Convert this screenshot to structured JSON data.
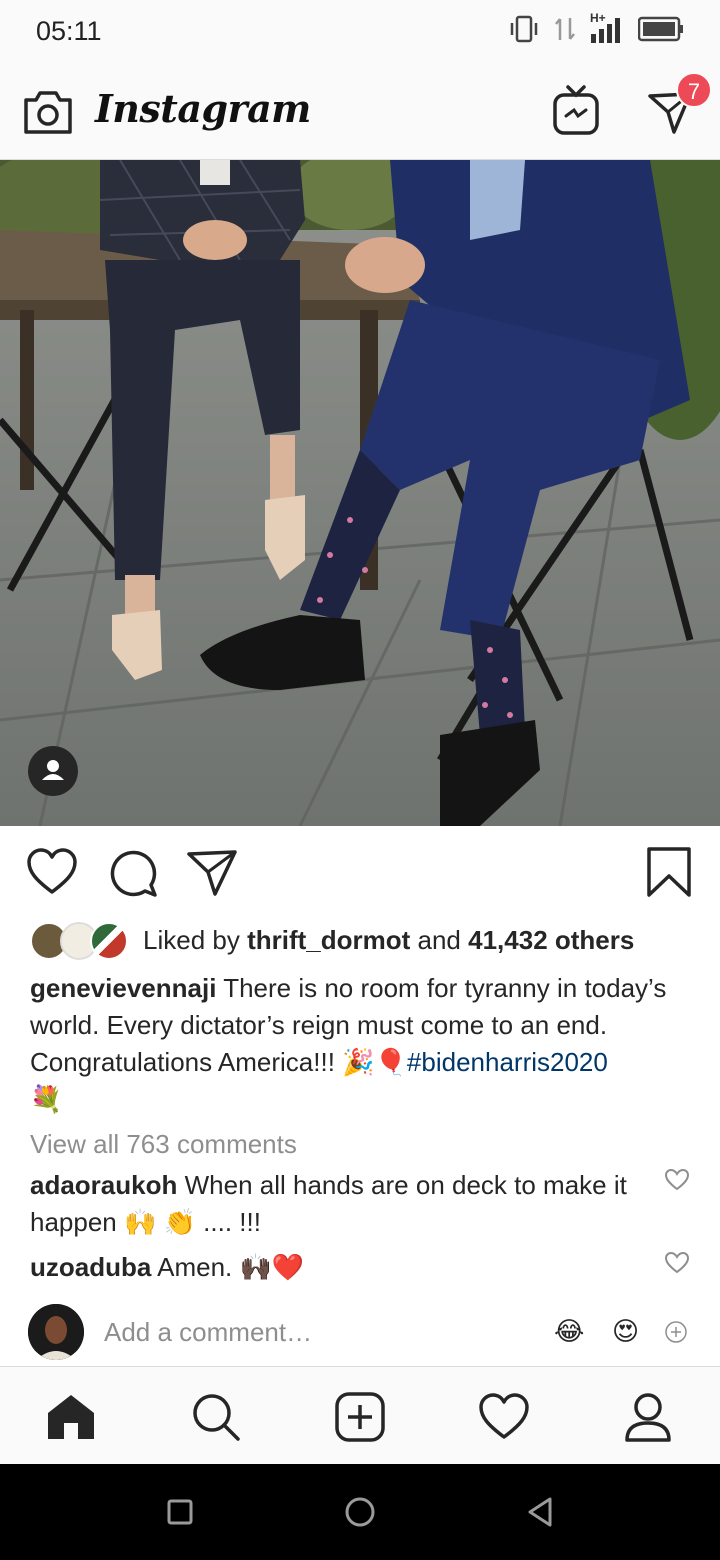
{
  "status_bar": {
    "time": "05:11",
    "network_label": "H+",
    "icons": [
      "vibrate-icon",
      "data-transfer-icon",
      "signal-icon",
      "battery-icon"
    ]
  },
  "header": {
    "app_title": "Instagram",
    "notification_count": "7",
    "icons": [
      "camera-icon",
      "igtv-icon",
      "direct-message-icon"
    ]
  },
  "post": {
    "actions": [
      "heart-icon",
      "comment-icon",
      "share-icon",
      "bookmark-icon"
    ],
    "likes": {
      "prefix": "Liked by",
      "user": "thrift_dormot",
      "connector": "and",
      "others": "41,432 others"
    },
    "caption": {
      "username": "genevievennaji",
      "text": "There is no room for tyranny in today’s world. Every dictator’s reign must come to an end. Congratulations America!!!",
      "emojis": "🎉🎈",
      "hashtag": "#bidenharris2020",
      "trailing_emoji": "💐"
    },
    "view_comments": "View all 763 comments",
    "comments": [
      {
        "username": "adaoraukoh",
        "text": "When all hands are on deck to make it happen 🙌 👏 .... !!!"
      },
      {
        "username": "uzoaduba",
        "text": "Amen. 🙌🏿❤️"
      }
    ],
    "add_comment_placeholder": "Add a comment…",
    "quick_emojis": [
      "😂",
      "😍"
    ]
  },
  "bottom_nav": [
    "home-icon",
    "search-icon",
    "new-post-icon",
    "activity-icon",
    "profile-icon"
  ],
  "system_nav": [
    "recents-icon",
    "home-circle-icon",
    "back-icon"
  ],
  "colors": {
    "badge": "#ed4956",
    "hashtag": "#00376b",
    "muted_text": "#8e8e8e",
    "suit": "#1f2f66"
  }
}
